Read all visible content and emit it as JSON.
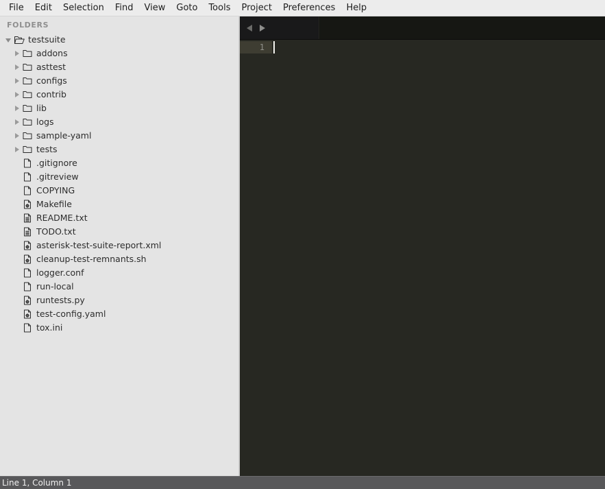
{
  "menubar": {
    "items": [
      {
        "label": "File"
      },
      {
        "label": "Edit"
      },
      {
        "label": "Selection"
      },
      {
        "label": "Find"
      },
      {
        "label": "View"
      },
      {
        "label": "Goto"
      },
      {
        "label": "Tools"
      },
      {
        "label": "Project"
      },
      {
        "label": "Preferences"
      },
      {
        "label": "Help"
      }
    ]
  },
  "sidebar": {
    "header": "FOLDERS",
    "root": {
      "label": "testsuite",
      "icon": "folder-open-icon",
      "expanded": true,
      "arrow": "chevron-down-icon"
    },
    "items": [
      {
        "label": "addons",
        "type": "folder",
        "icon": "folder-icon",
        "arrow": "chevron-right-icon"
      },
      {
        "label": "asttest",
        "type": "folder",
        "icon": "folder-icon",
        "arrow": "chevron-right-icon"
      },
      {
        "label": "configs",
        "type": "folder",
        "icon": "folder-icon",
        "arrow": "chevron-right-icon"
      },
      {
        "label": "contrib",
        "type": "folder",
        "icon": "folder-icon",
        "arrow": "chevron-right-icon"
      },
      {
        "label": "lib",
        "type": "folder",
        "icon": "folder-icon",
        "arrow": "chevron-right-icon"
      },
      {
        "label": "logs",
        "type": "folder",
        "icon": "folder-icon",
        "arrow": "chevron-right-icon"
      },
      {
        "label": "sample-yaml",
        "type": "folder",
        "icon": "folder-icon",
        "arrow": "chevron-right-icon"
      },
      {
        "label": "tests",
        "type": "folder",
        "icon": "folder-icon",
        "arrow": "chevron-right-icon"
      },
      {
        "label": ".gitignore",
        "type": "file",
        "icon": "file-plain-icon",
        "arrow": "none"
      },
      {
        "label": ".gitreview",
        "type": "file",
        "icon": "file-plain-icon",
        "arrow": "none"
      },
      {
        "label": "COPYING",
        "type": "file",
        "icon": "file-plain-icon",
        "arrow": "none"
      },
      {
        "label": "Makefile",
        "type": "file",
        "icon": "file-gear-icon",
        "arrow": "none"
      },
      {
        "label": "README.txt",
        "type": "file",
        "icon": "file-text-icon",
        "arrow": "none"
      },
      {
        "label": "TODO.txt",
        "type": "file",
        "icon": "file-text-icon",
        "arrow": "none"
      },
      {
        "label": "asterisk-test-suite-report.xml",
        "type": "file",
        "icon": "file-gear-icon",
        "arrow": "none"
      },
      {
        "label": "cleanup-test-remnants.sh",
        "type": "file",
        "icon": "file-gear-icon",
        "arrow": "none"
      },
      {
        "label": "logger.conf",
        "type": "file",
        "icon": "file-plain-icon",
        "arrow": "none"
      },
      {
        "label": "run-local",
        "type": "file",
        "icon": "file-plain-icon",
        "arrow": "none"
      },
      {
        "label": "runtests.py",
        "type": "file",
        "icon": "file-gear-icon",
        "arrow": "none"
      },
      {
        "label": "test-config.yaml",
        "type": "file",
        "icon": "file-gear-icon",
        "arrow": "none"
      },
      {
        "label": "tox.ini",
        "type": "file",
        "icon": "file-plain-icon",
        "arrow": "none"
      }
    ]
  },
  "editor": {
    "tabbar": {
      "prev_arrow": "arrow-left-icon",
      "next_arrow": "arrow-right-icon",
      "tabs": []
    },
    "line_numbers": [
      "1"
    ],
    "content": "",
    "cursor_line": 1,
    "cursor_column": 1
  },
  "statusbar": {
    "position": "Line 1, Column 1"
  },
  "colors": {
    "menubar_bg": "#ececec",
    "sidebar_bg": "#e4e4e4",
    "editor_bg": "#272822",
    "tabbar_bg": "#19191a",
    "gutter_active_bg": "#3e3d32",
    "statusbar_bg": "#58585a",
    "caret": "#f8f8f2"
  }
}
